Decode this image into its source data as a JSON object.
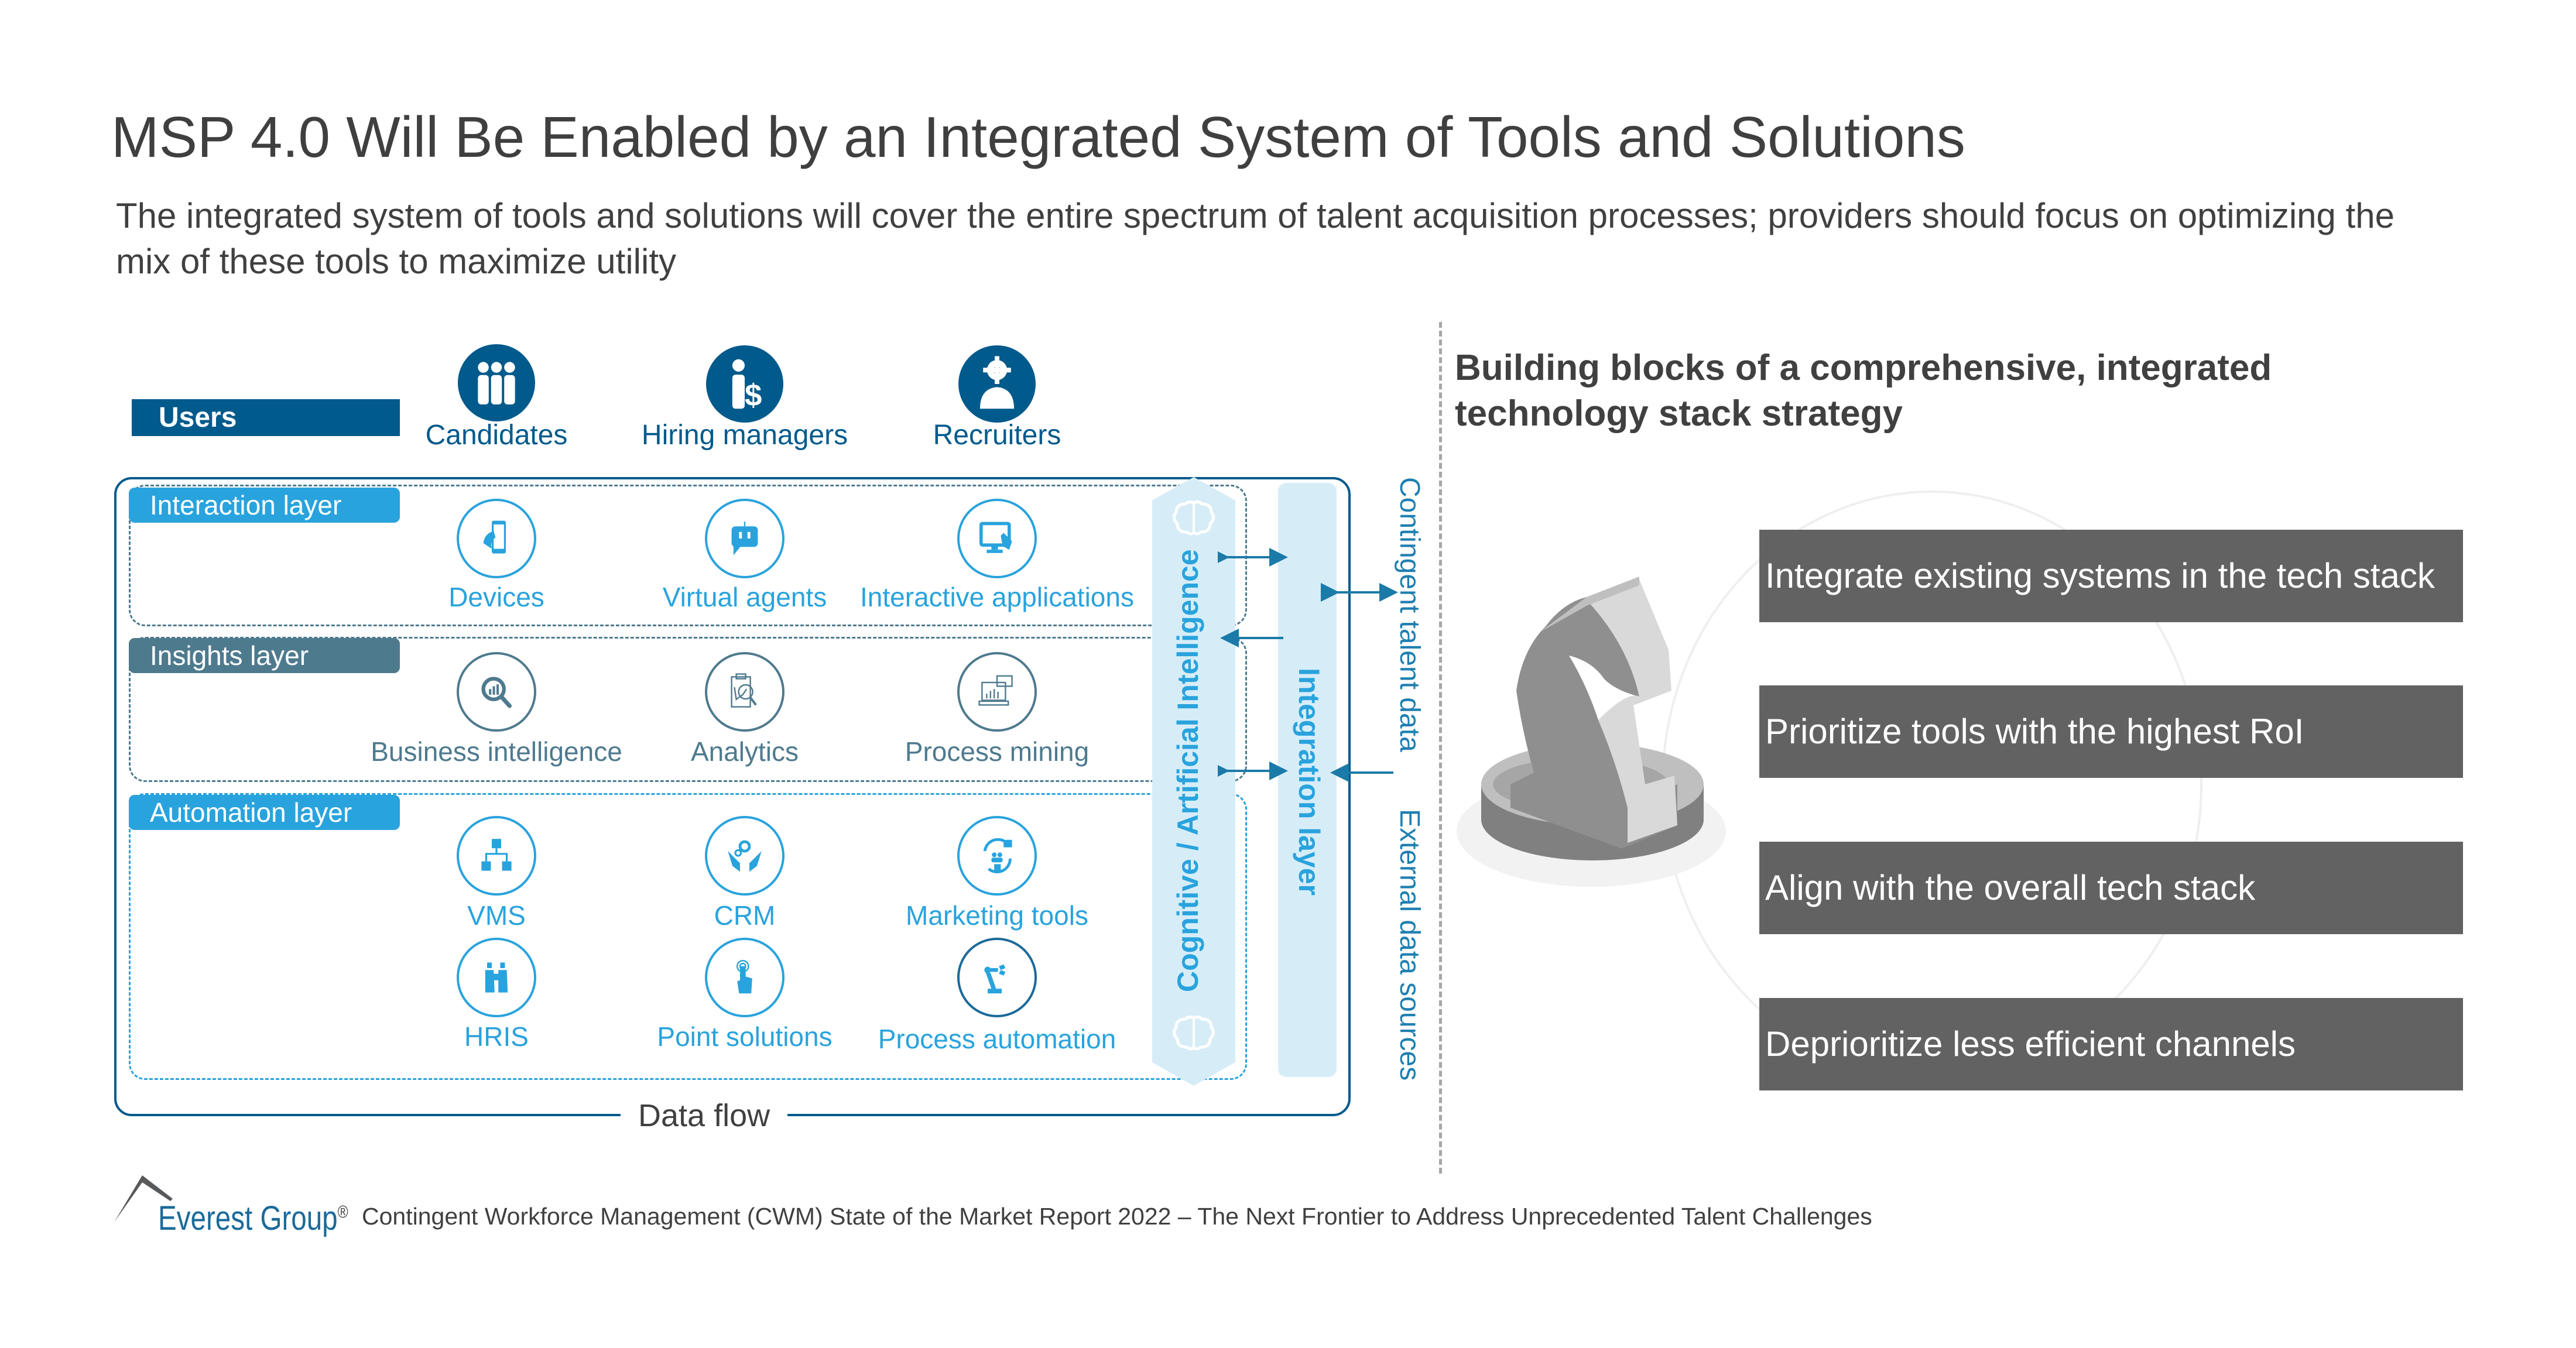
{
  "header": {
    "title": "MSP 4.0 Will Be Enabled by an Integrated System of Tools and Solutions",
    "subtitle": "The integrated system of tools and solutions will cover the entire spectrum of talent acquisition processes; providers should focus on optimizing the mix of these tools to maximize utility"
  },
  "colors": {
    "dark_blue": "#005a8c",
    "interaction_blue": "#29a3dd",
    "insights_slate": "#4e7a8e",
    "light_blue_fill": "#d6edf8",
    "box_gray": "#626262"
  },
  "users": {
    "tag": "Users",
    "items": [
      {
        "label": "Candidates",
        "icon": "group-people-icon"
      },
      {
        "label": "Hiring managers",
        "icon": "manager-dollar-icon"
      },
      {
        "label": "Recruiters",
        "icon": "recruiter-gear-icon"
      }
    ]
  },
  "layers": {
    "interaction": {
      "tag": "Interaction layer",
      "items": [
        {
          "label": "Devices",
          "icon": "smartphone-hand-icon"
        },
        {
          "label": "Virtual agents",
          "icon": "chatbot-icon"
        },
        {
          "label": "Interactive applications",
          "icon": "touch-monitor-icon"
        }
      ]
    },
    "insights": {
      "tag": "Insights layer",
      "items": [
        {
          "label": "Business intelligence",
          "icon": "magnifier-chart-icon"
        },
        {
          "label": "Analytics",
          "icon": "clipboard-analytics-icon"
        },
        {
          "label": "Process mining",
          "icon": "laptop-chart-icon"
        }
      ]
    },
    "automation": {
      "tag": "Automation layer",
      "items": [
        {
          "label": "VMS",
          "icon": "cubes-network-icon"
        },
        {
          "label": "CRM",
          "icon": "hands-gears-icon"
        },
        {
          "label": "Marketing tools",
          "icon": "marketing-cycle-icon"
        },
        {
          "label": "HRIS",
          "icon": "binoculars-icon"
        },
        {
          "label": "Point solutions",
          "icon": "finger-tap-icon"
        },
        {
          "label": "Process automation",
          "icon": "robot-arm-icon"
        }
      ]
    }
  },
  "side": {
    "ai_label": "Cognitive / Artificial Intelligence",
    "integration_label": "Integration layer",
    "contingent_data": "Contingent talent data",
    "external_data": "External data sources",
    "data_flow": "Data flow"
  },
  "right_panel": {
    "heading": "Building blocks of a comprehensive, integrated technology stack strategy",
    "blocks": [
      "Integrate existing systems in the tech stack",
      "Prioritize tools with the highest RoI",
      "Align with the overall tech stack",
      "Deprioritize less efficient channels"
    ]
  },
  "footer": {
    "logo": "Everest Group",
    "registered": "®",
    "source": "Contingent Workforce Management (CWM) State of the Market Report 2022 – The Next Frontier to Address Unprecedented Talent Challenges"
  }
}
